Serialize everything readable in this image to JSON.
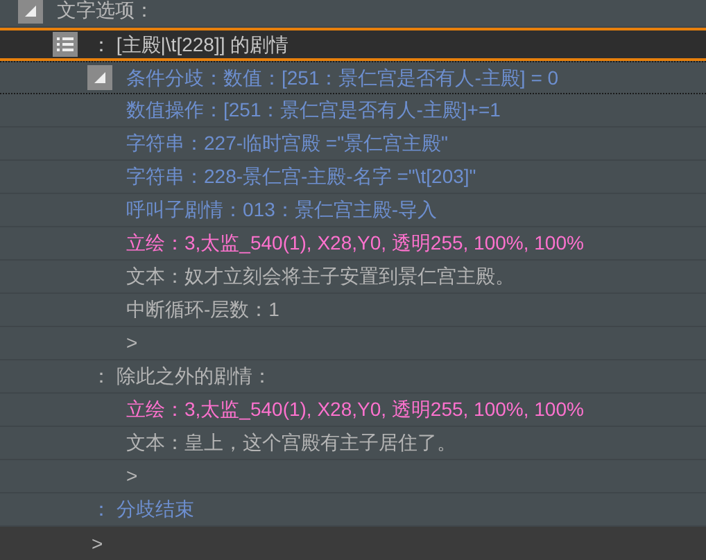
{
  "rows": [
    {
      "kind": "option",
      "text": "文字选项：",
      "expanded": true,
      "selected": false,
      "children": [
        {
          "kind": "case",
          "text": "： [主殿|\\t[228]] 的剧情",
          "selected": true,
          "children": [
            {
              "kind": "condition",
              "text": "条件分歧：数值：[251：景仁宫是否有人-主殿] = 0",
              "expanded": true,
              "selected": false
            },
            {
              "kind": "variable",
              "text": "数值操作：[251：景仁宫是否有人-主殿]+=1",
              "selected": false
            },
            {
              "kind": "variable",
              "text": "字符串：227-临时宫殿 =\"景仁宫主殿\"",
              "selected": false
            },
            {
              "kind": "variable",
              "text": "字符串：228-景仁宫-主殿-名字 =\"\\t[203]\"",
              "selected": false
            },
            {
              "kind": "variable",
              "text": "呼叫子剧情：013：景仁宫主殿-导入",
              "selected": false
            },
            {
              "kind": "picture",
              "text": "立绘：3,太监_540(1), X28,Y0, 透明255, 100%, 100%",
              "selected": false
            },
            {
              "kind": "text",
              "text": "文本：奴才立刻会将主子安置到景仁宫主殿。",
              "selected": false
            },
            {
              "kind": "text",
              "text": "中断循环-层数：1",
              "selected": false
            },
            {
              "kind": "text",
              "text": ">",
              "selected": false
            }
          ]
        },
        {
          "kind": "case-text",
          "text": "： 除此之外的剧情：",
          "selected": false,
          "children": [
            {
              "kind": "picture",
              "text": "立绘：3,太监_540(1), X28,Y0, 透明255, 100%, 100%",
              "selected": false
            },
            {
              "kind": "text",
              "text": "文本：皇上，这个宫殿有主子居住了。",
              "selected": false
            },
            {
              "kind": "text",
              "text": ">",
              "selected": false
            }
          ]
        },
        {
          "kind": "end",
          "text": "： 分歧结束",
          "selected": false
        },
        {
          "kind": "insert",
          "text": ">",
          "selected": false
        }
      ]
    }
  ]
}
